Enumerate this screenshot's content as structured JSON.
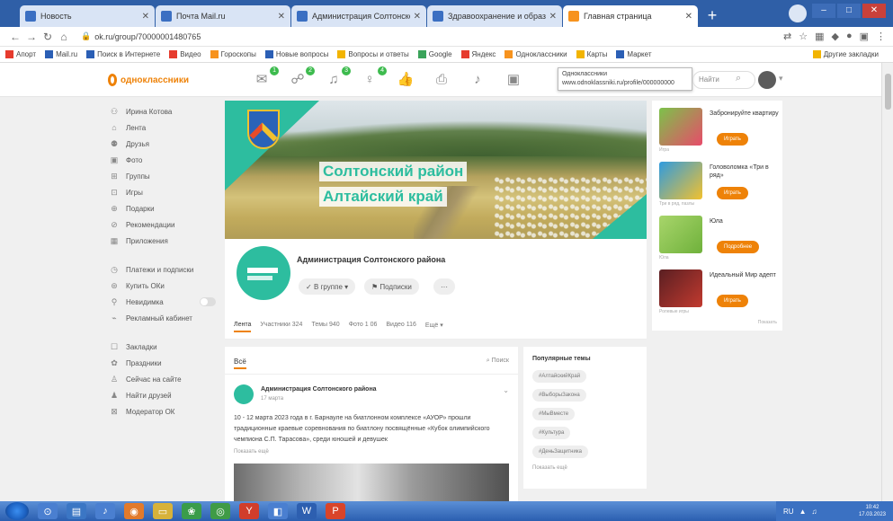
{
  "browser": {
    "tabs": [
      {
        "label": "Новость",
        "active": false
      },
      {
        "label": "Почта Mail.ru",
        "active": false
      },
      {
        "label": "Администрация Солтонского р",
        "active": false
      },
      {
        "label": "Здравоохранение и образование",
        "active": false
      },
      {
        "label": "Главная страница",
        "active": true
      }
    ],
    "new_tab": "+",
    "url": "ok.ru/group/70000001480765",
    "bookmarks": [
      "Апорт",
      "Mail.ru",
      "Поиск в Интернете",
      "Видео",
      "Гороскопы",
      "Новые вопросы",
      "Вопросы и ответы",
      "Google",
      "Яндекс",
      "Одноклассники",
      "Карты",
      "Маркет"
    ],
    "other_bookmarks": "Другие закладки"
  },
  "ok": {
    "logo_text": "одноклассники",
    "badges": [
      "1",
      "2",
      "3",
      "4"
    ],
    "tooltip_lines": [
      "Одноклассники",
      "www.odnoklassniki.ru/profile/000000000"
    ],
    "search_placeholder": "Найти"
  },
  "leftnav": {
    "items": [
      {
        "label": "Ирина Котова",
        "icon": "user-icon"
      },
      {
        "label": "Лента",
        "icon": "feed-icon"
      },
      {
        "label": "Друзья",
        "icon": "friends-icon"
      },
      {
        "label": "Фото",
        "icon": "photo-icon"
      },
      {
        "label": "Группы",
        "icon": "groups-icon"
      },
      {
        "label": "Игры",
        "icon": "games-icon"
      },
      {
        "label": "Подарки",
        "icon": "gift-icon"
      },
      {
        "label": "Рекомендации",
        "icon": "recommend-icon"
      },
      {
        "label": "Приложения",
        "icon": "apps-icon"
      }
    ],
    "items2": [
      {
        "label": "Платежи и подписки",
        "icon": "payment-icon"
      },
      {
        "label": "Купить ОКи",
        "icon": "coin-icon"
      },
      {
        "label": "Невидимка",
        "icon": "invisible-icon"
      },
      {
        "label": "Рекламный кабинет",
        "icon": "ads-icon"
      }
    ],
    "items3": [
      {
        "label": "Закладки",
        "icon": "bookmark-icon"
      },
      {
        "label": "Праздники",
        "icon": "holiday-icon"
      },
      {
        "label": "Сейчас на сайте",
        "icon": "online-icon"
      },
      {
        "label": "Найти друзей",
        "icon": "find-friends-icon"
      },
      {
        "label": "Модератор ОК",
        "icon": "moderator-icon"
      }
    ]
  },
  "cover": {
    "line1": "Солтонский район",
    "line2": "Алтайский край"
  },
  "group": {
    "name": "Администрация Солтонского района",
    "in_group_button": "В группе",
    "subscribe_button": "Подписки",
    "more_button": "···",
    "tabs": [
      "Лента",
      "Участники 324",
      "Темы 940",
      "Фото 1 06",
      "Видео 116",
      "Ещё"
    ]
  },
  "feed": {
    "all_tab": "Всё",
    "search": "Поиск",
    "post": {
      "author": "Администрация Солтонского района",
      "date": "17 марта",
      "text": "10 - 12 марта 2023 года в г. Барнауле на биатлонном комплексе «АУОР» прошли традиционные краевые соревнования по биатлону посвящённые «Кубок олимпийского чемпиона С.П. Тарасова», среди юношей и девушек",
      "more": "Показать ещё"
    }
  },
  "popular": {
    "title": "Популярные темы",
    "tags": [
      "#АлтайскийКрай",
      "#ВыборыЗакона",
      "#МыВместе",
      "#Культура",
      "#ДеньЗащитника"
    ],
    "show_more": "Показать ещё"
  },
  "games": {
    "items": [
      {
        "name": "Забронируйте квартиру",
        "button": "Играть",
        "sub": "Игра",
        "colors": [
          "#7cc24a",
          "#e84b6a"
        ]
      },
      {
        "name": "Головоломка «Три в ряд»",
        "button": "Играть",
        "sub": "Три в ряд, пазлы",
        "colors": [
          "#2f9be0",
          "#f2c12e"
        ]
      },
      {
        "name": "Юла",
        "button": "Подробнее",
        "sub": "Юла",
        "colors": [
          "#a8d56b",
          "#6fb13b"
        ]
      },
      {
        "name": "Идеальный Мир адепт",
        "button": "Играть",
        "sub": "Ролевые игры",
        "colors": [
          "#5a1f22",
          "#c23a2f"
        ]
      }
    ],
    "more": "Показать"
  },
  "taskbar": {
    "time": "10:42",
    "date": "17.03.2023"
  }
}
